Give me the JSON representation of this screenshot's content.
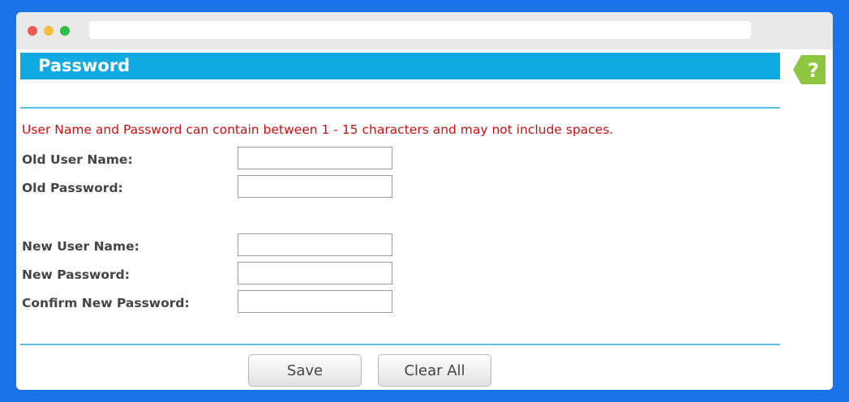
{
  "page": {
    "title": "Password",
    "notice": "User Name and Password can contain between 1 - 15 characters and may not include spaces.",
    "help_label": "?"
  },
  "form": {
    "old_user_name_label": "Old User Name:",
    "old_password_label": "Old Password:",
    "new_user_name_label": "New User Name:",
    "new_password_label": "New Password:",
    "confirm_password_label": "Confirm New Password:",
    "old_user_name_value": "",
    "old_password_value": "",
    "new_user_name_value": "",
    "new_password_value": "",
    "confirm_password_value": ""
  },
  "buttons": {
    "save_label": "Save",
    "clear_label": "Clear All"
  },
  "colors": {
    "header": "#10aae3",
    "notice": "#d20f0f",
    "help_tab": "#8cc63f",
    "background": "#1a73e8"
  }
}
